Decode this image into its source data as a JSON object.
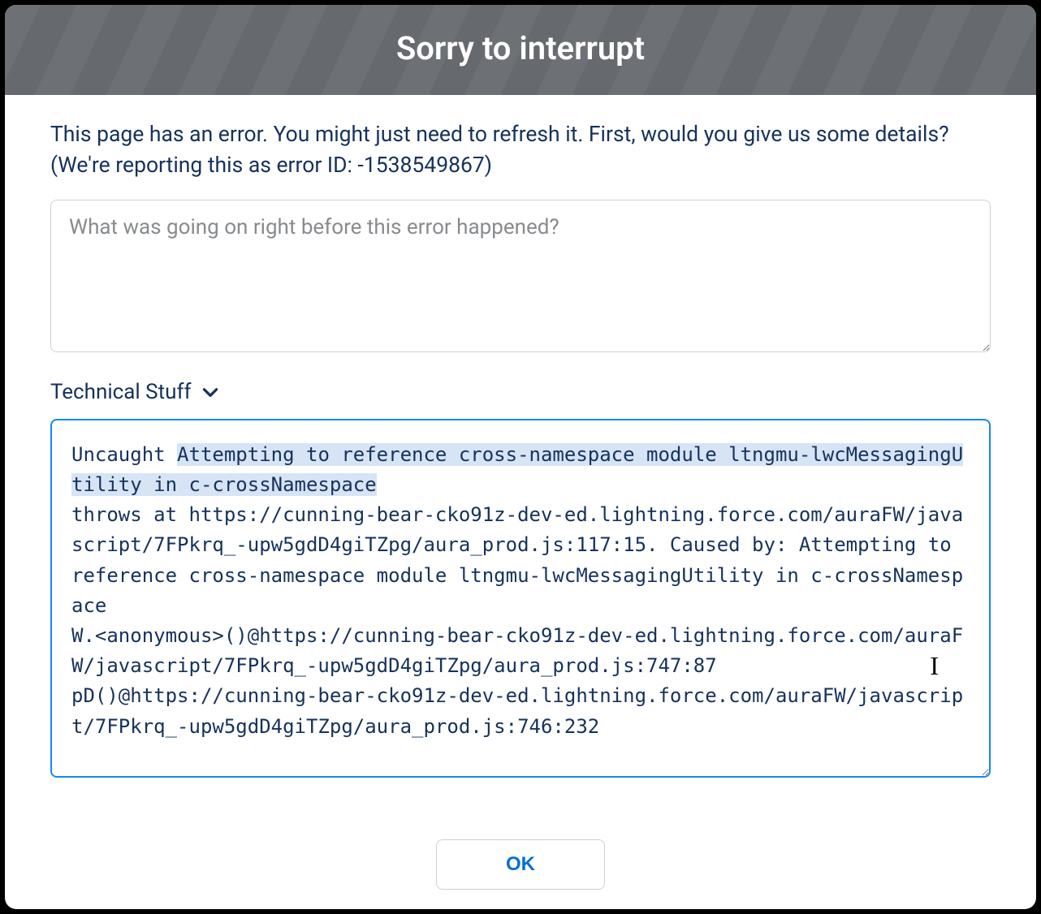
{
  "header": {
    "title": "Sorry to interrupt"
  },
  "body": {
    "error_message": "This page has an error. You might just need to refresh it. First, would you give us some details? (We're reporting this as error ID: -1538549867)",
    "details_placeholder": "What was going on right before this error happened?",
    "details_value": "",
    "tech_toggle_label": "Technical Stuff",
    "tech_prefix": "Uncaught ",
    "tech_highlight": "Attempting to reference cross-namespace module ltngmu-lwcMessagingUtility in c-crossNamespace",
    "tech_rest": "\nthrows at https://cunning-bear-cko91z-dev-ed.lightning.force.com/auraFW/javascript/7FPkrq_-upw5gdD4giTZpg/aura_prod.js:117:15. Caused by: Attempting to reference cross-namespace module ltngmu-lwcMessagingUtility in c-crossNamespace\nW.<anonymous>()@https://cunning-bear-cko91z-dev-ed.lightning.force.com/auraFW/javascript/7FPkrq_-upw5gdD4giTZpg/aura_prod.js:747:87\npD()@https://cunning-bear-cko91z-dev-ed.lightning.force.com/auraFW/javascript/7FPkrq_-upw5gdD4giTZpg/aura_prod.js:746:232"
  },
  "footer": {
    "ok_label": "OK"
  }
}
